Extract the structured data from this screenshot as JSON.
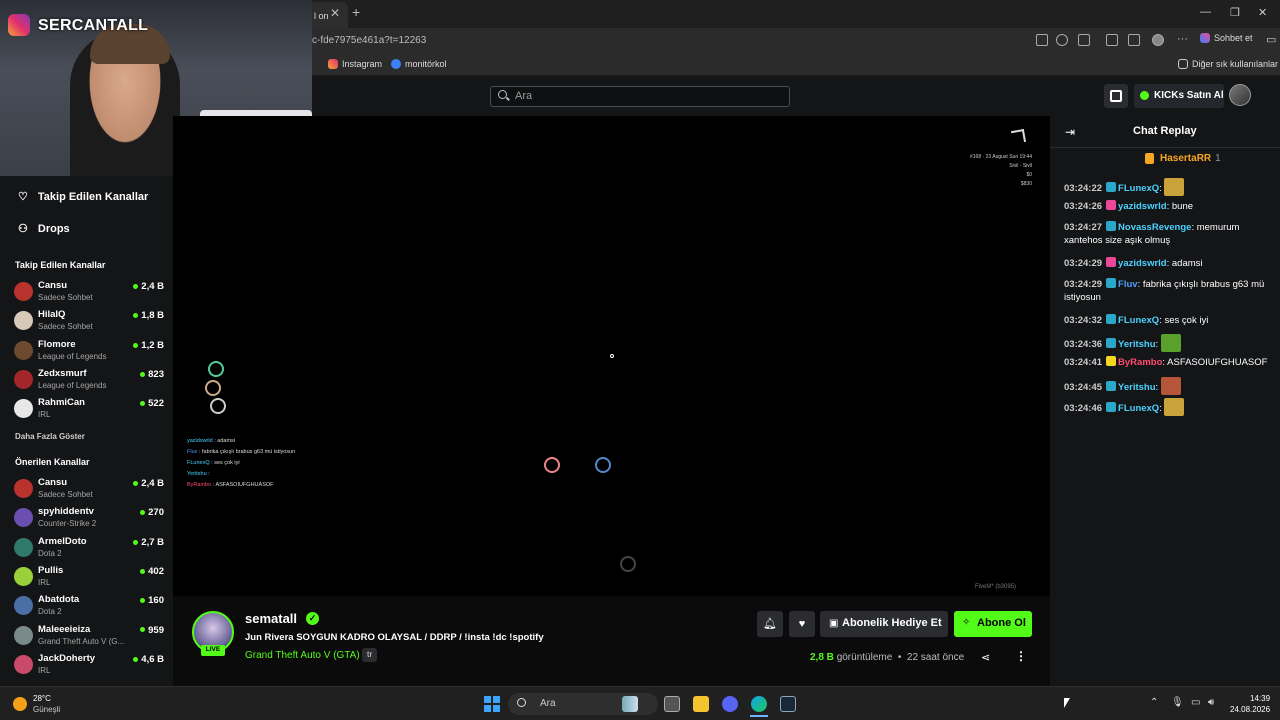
{
  "browser": {
    "tab_title": "l on",
    "url": "c-fde7975e461a?t=12263",
    "bookmarks": [
      "Instagram",
      "monitörkol"
    ],
    "other_bookmarks": "Diğer sık kullanılanlar",
    "copilot_label": "Sohbet et"
  },
  "webcam": {
    "overlay_name": "SERCANTALL"
  },
  "header": {
    "search_placeholder": "Ara",
    "kicks_button": "KICKs Satın Al"
  },
  "sidebar": {
    "nav": [
      {
        "label": "Takip Edilen Kanallar",
        "icon": "heart-icon"
      },
      {
        "label": "Drops",
        "icon": "drops-icon"
      }
    ],
    "followed_heading": "Takip Edilen Kanallar",
    "followed": [
      {
        "name": "Cansu",
        "category": "Sadece Sohbet",
        "viewers": "2,4 B",
        "color": "#b8332e"
      },
      {
        "name": "HilalQ",
        "category": "Sadece Sohbet",
        "viewers": "1,8 B",
        "color": "#d8c8b8"
      },
      {
        "name": "Flomore",
        "category": "League of Legends",
        "viewers": "1,2 B",
        "color": "#6b4a2e"
      },
      {
        "name": "Zedxsmurf",
        "category": "League of Legends",
        "viewers": "823",
        "color": "#a3262a"
      },
      {
        "name": "RahmiCan",
        "category": "IRL",
        "viewers": "522",
        "color": "#e8e8e8"
      }
    ],
    "show_more": "Daha Fazla Göster",
    "recommended_heading": "Önerilen Kanallar",
    "recommended": [
      {
        "name": "Cansu",
        "category": "Sadece Sohbet",
        "viewers": "2,4 B",
        "color": "#b8332e"
      },
      {
        "name": "spyhiddentv",
        "category": "Counter-Strike 2",
        "viewers": "270",
        "color": "#6a4fb0"
      },
      {
        "name": "ArmelDoto",
        "category": "Dota 2",
        "viewers": "2,7 B",
        "color": "#2f7a6b"
      },
      {
        "name": "Pullis",
        "category": "IRL",
        "viewers": "402",
        "color": "#9ad13a"
      },
      {
        "name": "Abatdota",
        "category": "Dota 2",
        "viewers": "160",
        "color": "#4a6fa5"
      },
      {
        "name": "Maleeeieiza",
        "category": "Grand Theft Auto V (G...",
        "viewers": "959",
        "color": "#7a8a8a"
      },
      {
        "name": "JackDoherty",
        "category": "IRL",
        "viewers": "4,6 B",
        "color": "#c94a6a"
      }
    ]
  },
  "video": {
    "hud": [
      "#168 · 23 August Sun 19:44",
      "Sivil - Sivil",
      "$0",
      "$830"
    ],
    "game_chat": [
      {
        "user": "yazidswrld",
        "text": "adamsi",
        "color": "#4bd1ff"
      },
      {
        "user": "Fluv",
        "text": "fabrika çıkışlı brabus g63 mü istiyosun",
        "color": "#4b9dff"
      },
      {
        "user": "FLunexQ",
        "text": "ses çok iyi",
        "color": "#4bd1ff"
      },
      {
        "user": "Yeritshu",
        "text": "",
        "color": "#4bd1ff"
      },
      {
        "user": "ByRambo",
        "text": "ASFASOIUFGHUASOF",
        "color": "#ff4b6e"
      }
    ],
    "watermark": "FiveM* (b3095)"
  },
  "stream": {
    "streamer": "sematall",
    "live_label": "LIVE",
    "title": "Jun Rivera SOYGUN KADRO OLAYSAL / DDRP /  !insta !dc !spotify",
    "category": "Grand Theft Auto V (GTA)",
    "language": "tr",
    "gift_button": "Abonelik Hediye Et",
    "subscribe_button": "Abone Ol",
    "viewers": "2,8 B",
    "viewers_suffix": "görüntüleme",
    "time_ago": "22 saat önce"
  },
  "chat": {
    "title": "Chat Replay",
    "pinned_user": "HasertaRR",
    "pinned_count": "1",
    "messages": [
      {
        "time": "03:24:22",
        "user": "FLunexQ",
        "color": "#4bd1ff",
        "text": "",
        "emote": "#c9a33a"
      },
      {
        "time": "03:24:26",
        "user": "yazidswrld",
        "color": "#4bd1ff",
        "text": "bune",
        "emote": ""
      },
      {
        "time": "03:24:27",
        "user": "NovassRevenge",
        "color": "#4bd1ff",
        "text": "memurum xantehos size aşık olmuş",
        "emote": ""
      },
      {
        "time": "03:24:29",
        "user": "yazidswrld",
        "color": "#4bd1ff",
        "text": "adamsi",
        "emote": ""
      },
      {
        "time": "03:24:29",
        "user": "Fluv",
        "color": "#4b9dff",
        "text": "fabrika çıkışlı brabus g63 mü istiyosun",
        "emote": ""
      },
      {
        "time": "03:24:32",
        "user": "FLunexQ",
        "color": "#4bd1ff",
        "text": "ses çok iyi",
        "emote": ""
      },
      {
        "time": "03:24:36",
        "user": "Yeritshu",
        "color": "#4bd1ff",
        "text": "",
        "emote": "#5aa02c"
      },
      {
        "time": "03:24:41",
        "user": "ByRambo",
        "color": "#ff4b6e",
        "text": "ASFASOIUFGHUASOF",
        "emote": ""
      },
      {
        "time": "03:24:45",
        "user": "Yeritshu",
        "color": "#4bd1ff",
        "text": "",
        "emote": "#b5553a"
      },
      {
        "time": "03:24:46",
        "user": "FLunexQ",
        "color": "#4bd1ff",
        "text": "",
        "emote": "#c9a33a"
      }
    ]
  },
  "taskbar": {
    "weather_temp": "28°C",
    "weather_desc": "Güneşli",
    "search_placeholder": "Ara",
    "time": "14:39",
    "date": "24.08.2026"
  },
  "colors": {
    "accent": "#53fc18",
    "panel": "#141517",
    "background": "#0b0b0c"
  }
}
